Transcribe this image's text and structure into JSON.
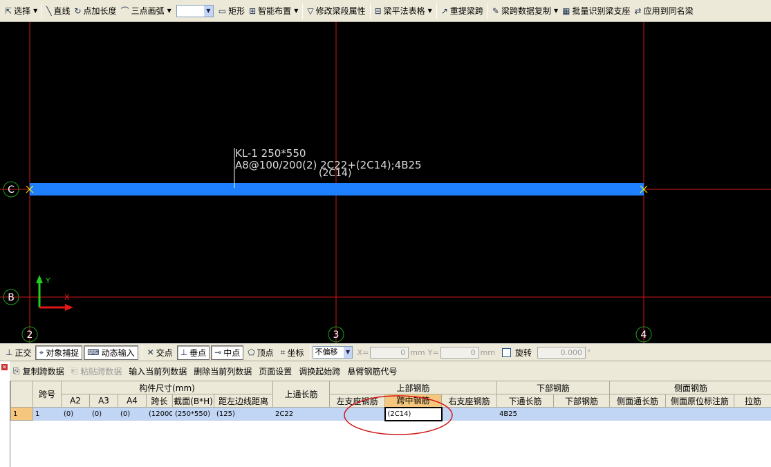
{
  "toolbar": {
    "select": "选择",
    "line": "直线",
    "point_extend": "点加长度",
    "three_point_arc": "三点画弧",
    "combo_value": "",
    "rect": "矩形",
    "smart_layout": "智能布置",
    "modify_span_attr": "修改梁段属性",
    "beam_table": "梁平法表格",
    "re_extract_span": "重提梁跨",
    "span_data_copy": "梁跨数据复制",
    "batch_identify_support": "批量识别梁支座",
    "apply_same_name": "应用到同名梁"
  },
  "canvas": {
    "beam_label_line1": "KL-1 250*550",
    "beam_label_line2": "A8@100/200(2) 2C22+(2C14);4B25",
    "span_label": "(2C14)",
    "axes": {
      "C": "C",
      "B": "B",
      "2": "2",
      "3": "3",
      "4": "4"
    },
    "ucs_y": "Y",
    "ucs_x": "X",
    "colors": {
      "beam": "#1e7fff",
      "grid": "#d01818",
      "axis_bubble": "#1f9d1f",
      "text": "#dcdcdc"
    }
  },
  "status": {
    "ortho": "正交",
    "object_snap": "对象捕捉",
    "dynamic_input": "动态输入",
    "intersection": "交点",
    "perpendicular": "垂点",
    "midpoint": "中点",
    "vertex": "顶点",
    "coordinate": "坐标",
    "offset_mode": "不偏移",
    "x_label": "X=",
    "x_value": "0",
    "y_label": "Y=",
    "y_value": "0",
    "unit": "mm",
    "rotate": "旋转",
    "rotate_value": "0.000",
    "degree": "°"
  },
  "panel": {
    "copy_span_data": "复制跨数据",
    "paste_span_data": "粘贴跨数据",
    "input_current_col": "输入当前列数据",
    "delete_current_col": "删除当前列数据",
    "page_setup": "页面设置",
    "swap_start_span": "调换起始跨",
    "cantilever_code": "悬臂钢筋代号"
  },
  "table": {
    "group_headers": {
      "span_no": "跨号",
      "component_size": "构件尺寸(mm)",
      "top_through": "上通长筋",
      "top_rebar": "上部钢筋",
      "bottom_rebar": "下部钢筋",
      "side_rebar": "侧面钢筋"
    },
    "sub_headers": {
      "a2": "A2",
      "a3": "A3",
      "a4": "A4",
      "span_length": "跨长",
      "section": "截面(B*H)",
      "left_edge_dist": "距左边线距离",
      "left_support": "左支座钢筋",
      "mid_span": "跨中钢筋",
      "right_support": "右支座钢筋",
      "bottom_through": "下通长筋",
      "bottom_rebar": "下部钢筋",
      "side_through": "侧面通长筋",
      "side_in_situ": "侧面原位标注筋",
      "tie_bar": "拉筋"
    },
    "row": {
      "index": "1",
      "span_no": "1",
      "a2": "(0)",
      "a3": "(0)",
      "a4": "(0)",
      "span_length": "(12000",
      "section": "(250*550)",
      "left_edge_dist": "(125)",
      "top_through": "2C22",
      "left_support": "",
      "mid_span": "(2C14)",
      "right_support": "",
      "bottom_through": "4B25",
      "bottom_rebar": "",
      "side_through": "",
      "side_in_situ": "",
      "tie_bar": ""
    },
    "highlight_color": "#f5c77e",
    "annotation_color": "#d01818"
  }
}
